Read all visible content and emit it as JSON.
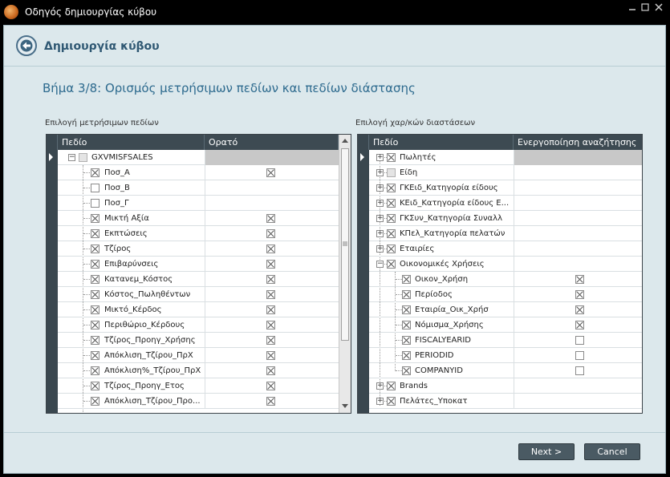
{
  "window": {
    "title": "Οδηγός δημιουργίας κύβου",
    "controls": [
      "minimize-icon",
      "maximize-icon",
      "close-icon"
    ]
  },
  "header": {
    "title": "Δημιουργία κύβου",
    "back_icon": "back-arrow-icon"
  },
  "step": {
    "title": "Βήμα 3/8: Ορισμός μετρήσιμων πεδίων και πεδίων διάστασης"
  },
  "measures": {
    "label": "Επιλογή μετρήσιμων πεδίων",
    "columns": [
      "Πεδίο",
      "Ορατό"
    ],
    "root": {
      "name": "GXVMISFSALES",
      "expanded": true
    },
    "rows": [
      {
        "name": "Ποσ_Α",
        "checked": true,
        "visible": true
      },
      {
        "name": "Ποσ_Β",
        "checked": false,
        "visible": false
      },
      {
        "name": "Ποσ_Γ",
        "checked": false,
        "visible": false
      },
      {
        "name": "Μικτή Αξία",
        "checked": true,
        "visible": true
      },
      {
        "name": "Εκπτώσεις",
        "checked": true,
        "visible": true
      },
      {
        "name": "Τζίρος",
        "checked": true,
        "visible": true
      },
      {
        "name": "Επιβαρύνσεις",
        "checked": true,
        "visible": true
      },
      {
        "name": "Κατανεμ_Κόστος",
        "checked": true,
        "visible": true
      },
      {
        "name": "Κόστος_Πωληθέντων",
        "checked": true,
        "visible": true
      },
      {
        "name": "Μικτό_Κέρδος",
        "checked": true,
        "visible": true
      },
      {
        "name": "Περιθώριο_Κέρδους",
        "checked": true,
        "visible": true
      },
      {
        "name": "Τζίρος_Προηγ_Χρήσης",
        "checked": true,
        "visible": true
      },
      {
        "name": "Απόκλιση_Τζίρου_ΠρΧ",
        "checked": true,
        "visible": true
      },
      {
        "name": "Απόκλιση%_Τζίρου_ΠρΧ",
        "checked": true,
        "visible": true
      },
      {
        "name": "Τζίρος_Προηγ_Ετος",
        "checked": true,
        "visible": true
      },
      {
        "name": "Απόκλιση_Τζίρου_Προ...",
        "checked": true,
        "visible": true
      }
    ]
  },
  "dimensions": {
    "label": "Επιλογή χαρ/κών διαστάσεων",
    "columns": [
      "Πεδίο",
      "Ενεργοποίηση αναζήτησης"
    ],
    "rows": [
      {
        "name": "Πωλητές",
        "level": 0,
        "checked": true,
        "expander": "+",
        "search": null,
        "selected": true
      },
      {
        "name": "Είδη",
        "level": 0,
        "checked": false,
        "expander": "+",
        "search": null
      },
      {
        "name": "ΓΚΕιδ_Κατηγορία είδους",
        "level": 0,
        "checked": true,
        "expander": "+",
        "search": null
      },
      {
        "name": "ΚΕιδ_Κατηγορία είδους Ε...",
        "level": 0,
        "checked": true,
        "expander": "+",
        "search": null
      },
      {
        "name": "ΓΚΣυν_Κατηγορία Συναλλ",
        "level": 0,
        "checked": true,
        "expander": "+",
        "search": null
      },
      {
        "name": "ΚΠελ_Κατηγορία πελατών",
        "level": 0,
        "checked": true,
        "expander": "+",
        "search": null
      },
      {
        "name": "Εταιρίες",
        "level": 0,
        "checked": true,
        "expander": "+",
        "search": null
      },
      {
        "name": "Οικονομικές Χρήσεις",
        "level": 0,
        "checked": true,
        "expander": "-",
        "search": null
      },
      {
        "name": "Οικον_Χρήση",
        "level": 1,
        "checked": true,
        "expander": "",
        "search": true
      },
      {
        "name": "Περίοδος",
        "level": 1,
        "checked": true,
        "expander": "",
        "search": true
      },
      {
        "name": "Εταιρία_Οικ_Χρήσ",
        "level": 1,
        "checked": true,
        "expander": "",
        "search": true
      },
      {
        "name": "Νόμισμα_Χρήσης",
        "level": 1,
        "checked": true,
        "expander": "",
        "search": true
      },
      {
        "name": "FISCALYEARID",
        "level": 1,
        "checked": true,
        "expander": "",
        "search": false
      },
      {
        "name": "PERIODID",
        "level": 1,
        "checked": true,
        "expander": "",
        "search": false
      },
      {
        "name": "COMPANYID",
        "level": 1,
        "checked": true,
        "expander": "",
        "search": false
      },
      {
        "name": "Brands",
        "level": 0,
        "checked": true,
        "expander": "+",
        "search": null
      },
      {
        "name": "Πελάτες_Υποκατ",
        "level": 0,
        "checked": true,
        "expander": "+",
        "search": null
      }
    ]
  },
  "buttons": {
    "next": "Next >",
    "cancel": "Cancel"
  },
  "colors": {
    "background": "#dce8ec",
    "grid_header": "#3d4a52",
    "accent": "#2d6a8e"
  }
}
